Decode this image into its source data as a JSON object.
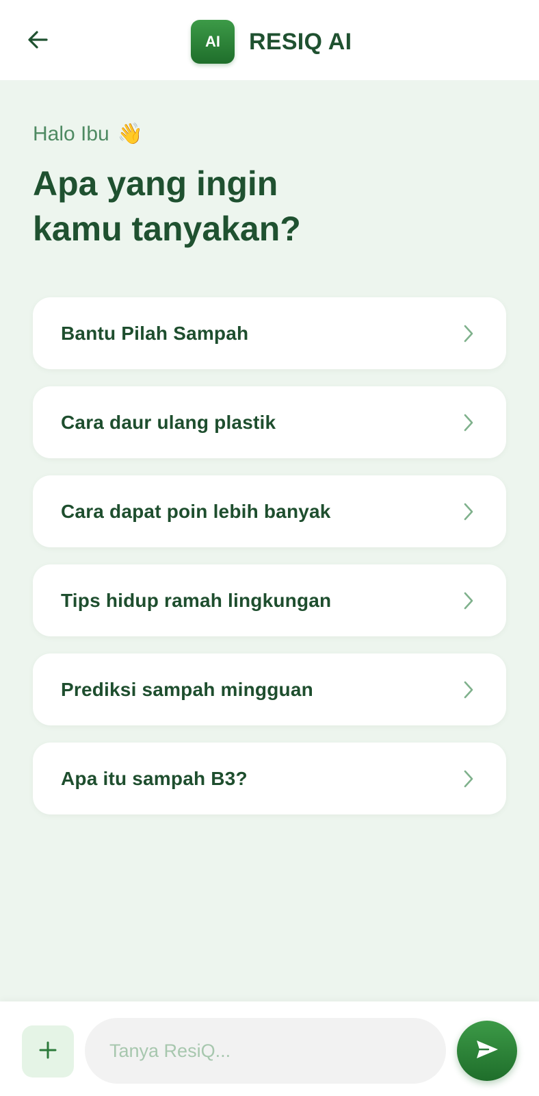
{
  "header": {
    "logo_text": "AI",
    "title": "RESIQ AI",
    "back_icon": "arrow-left-icon"
  },
  "main": {
    "greeting": "Halo Ibu",
    "greeting_emoji": "👋",
    "headline_line1": "Apa yang ingin",
    "headline_line2": "kamu tanyakan?",
    "suggestions": [
      {
        "label": "Bantu Pilah Sampah"
      },
      {
        "label": "Cara daur ulang plastik"
      },
      {
        "label": "Cara dapat poin lebih banyak"
      },
      {
        "label": "Tips hidup ramah lingkungan"
      },
      {
        "label": "Prediksi sampah mingguan"
      },
      {
        "label": "Apa itu sampah B3?"
      }
    ]
  },
  "composer": {
    "placeholder": "Tanya ResiQ...",
    "add_icon": "plus-icon",
    "send_icon": "send-icon"
  },
  "colors": {
    "primary": "#2b8a3e",
    "primary_dark": "#1f5130",
    "background": "#edf5ee",
    "card": "#ffffff",
    "greeting_text": "#4e8a62"
  }
}
